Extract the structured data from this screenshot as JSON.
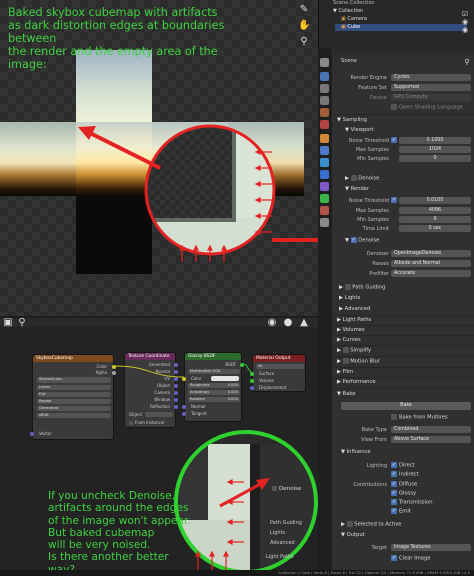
{
  "annotation_top": {
    "line1": "Baked skybox cubemap with artifacts",
    "line2": "as dark distortion edges at boundaries between",
    "line3": "the render and the empty area of the image:"
  },
  "annotation_bottom": {
    "line1": "If you uncheck Denoise,",
    "line2": "artifacts around the edges",
    "line3": "of the image won't appear.",
    "line4": "But baked cubemap",
    "line5": "will be very noised.",
    "line6": "Is there another better way?"
  },
  "outliner": {
    "title": "Scene Collection",
    "items": [
      "Collection",
      "Camera",
      "Cube"
    ]
  },
  "properties": {
    "scene_label": "Scene",
    "render_engine_label": "Render Engine",
    "render_engine_value": "Cycles",
    "feature_set_label": "Feature Set",
    "feature_set_value": "Supported",
    "device_label": "Device",
    "device_value": "GPU Compute",
    "osl_label": "Open Shading Language",
    "sampling_label": "Sampling",
    "viewport_label": "Viewport",
    "noise_threshold_label": "Noise Threshold",
    "viewport_noise_threshold": "0.1000",
    "max_samples_label": "Max Samples",
    "viewport_max_samples": "1024",
    "min_samples_label": "Min Samples",
    "viewport_min_samples": "0",
    "denoise_label": "Denoise",
    "render_label": "Render",
    "render_noise_threshold": "0.0100",
    "render_max_samples": "4096",
    "render_min_samples": "0",
    "time_limit_label": "Time Limit",
    "time_limit_value": "0 sec",
    "denoiser_label": "Denoiser",
    "denoiser_value": "OpenImageDenoise",
    "passes_label": "Passes",
    "passes_value": "Albedo and Normal",
    "prefilter_label": "Prefilter",
    "prefilter_value": "Accurate",
    "path_guiding_label": "Path Guiding",
    "lights_label": "Lights",
    "advanced_label": "Advanced",
    "light_paths_label": "Light Paths",
    "volumes_label": "Volumes",
    "curves_label": "Curves",
    "simplify_label": "Simplify",
    "motion_blur_label": "Motion Blur",
    "film_label": "Film",
    "performance_label": "Performance",
    "bake_label": "Bake",
    "bake_button": "Bake",
    "bake_from_multires_label": "Bake from Multires",
    "bake_type_label": "Bake Type",
    "bake_type_value": "Combined",
    "view_from_label": "View From",
    "view_from_value": "Above Surface",
    "influence_label": "Influence",
    "lighting_label": "Lighting",
    "direct_label": "Direct",
    "indirect_label": "Indirect",
    "contributions_label": "Contributions",
    "diffuse_label": "Diffuse",
    "glossy_label": "Glossy",
    "transmission_label": "Transmission",
    "emit_label": "Emit",
    "selected_to_active_label": "Selected to Active",
    "output_label": "Output",
    "target_label": "Target",
    "target_value": "Image Textures",
    "clear_image_label": "Clear Image"
  },
  "nodes": {
    "image_texture": {
      "title": "SkyboxCubemap",
      "out_color": "Color",
      "out_alpha": "Alpha",
      "image_name": "SkyboxCube...",
      "interpolation": "Linear",
      "projection": "Flat",
      "extension": "Repeat",
      "source": "Generated",
      "color_space": "sRGB",
      "vector_label": "Vector"
    },
    "texcoord": {
      "title": "Texture Coordinate",
      "outputs": [
        "Generated",
        "Normal",
        "UV",
        "Object",
        "Camera",
        "Window",
        "Reflection"
      ],
      "object_label": "Object",
      "from_instancer": "From Instancer"
    },
    "glossy": {
      "title": "Glossy BSDF",
      "bsdf": "BSDF",
      "distribution": "Multiscatter GGX",
      "color_label": "Color",
      "roughness_label": "Roughness",
      "roughness_value": "0.000",
      "anisotropy_label": "Anisotropy",
      "anisotropy_value": "0.000",
      "rotation_label": "Rotation",
      "rotation_value": "0.000",
      "normal_label": "Normal",
      "tangent_label": "Tangent"
    },
    "output": {
      "title": "Material Output",
      "target": "All",
      "surface": "Surface",
      "volume": "Volume",
      "displacement": "Displacement"
    }
  },
  "status_bar": {
    "text": "Collection | Cube | Verts 8 | Faces 6 | Tris 12 | Objects 1/2 | Memory 71.0 MiB | VRAM 3.0/8.0 GiB | 4.0"
  },
  "colors": {
    "annotation_green": "#3fd23f",
    "arrow_red": "#e52222",
    "blender_blue": "#4772b3"
  }
}
